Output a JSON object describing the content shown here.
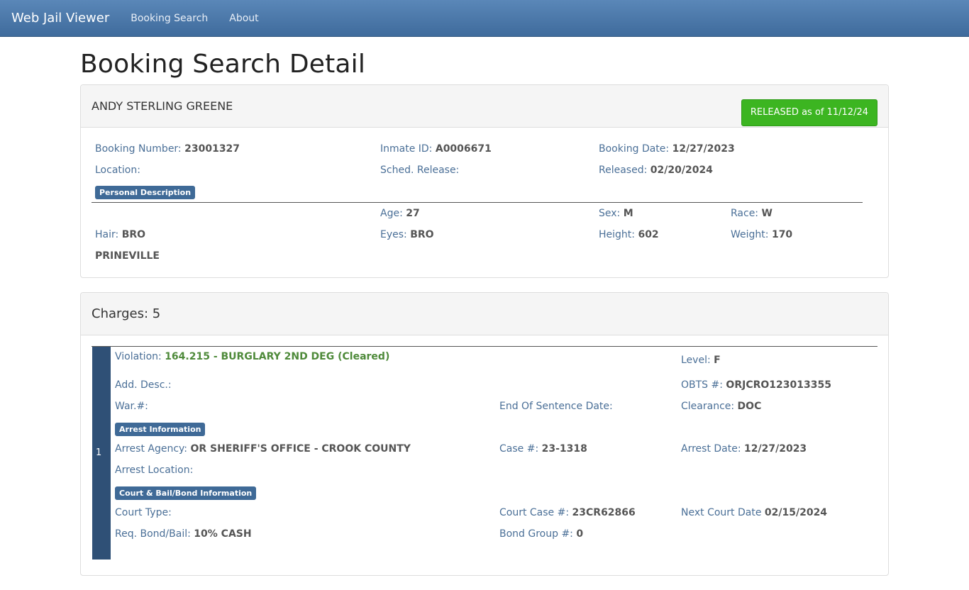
{
  "nav": {
    "brand": "Web Jail Viewer",
    "links": [
      "Booking Search",
      "About"
    ]
  },
  "page_title": "Booking Search Detail",
  "inmate": {
    "name": "ANDY STERLING GREENE",
    "status_button": "RELEASED as of 11/12/24",
    "booking_number_label": "Booking Number:",
    "booking_number": "23001327",
    "inmate_id_label": "Inmate ID:",
    "inmate_id": "A0006671",
    "booking_date_label": "Booking Date:",
    "booking_date": "12/27/2023",
    "location_label": "Location:",
    "sched_release_label": "Sched. Release:",
    "released_label": "Released:",
    "released": "02/20/2024",
    "personal_badge": "Personal Description",
    "age_label": "Age:",
    "age": "27",
    "sex_label": "Sex:",
    "sex": "M",
    "race_label": "Race:",
    "race": "W",
    "hair_label": "Hair:",
    "hair": "BRO",
    "eyes_label": "Eyes:",
    "eyes": "BRO",
    "height_label": "Height:",
    "height": "602",
    "weight_label": "Weight:",
    "weight": "170",
    "city": "PRINEVILLE"
  },
  "charges": {
    "heading": "Charges: 5",
    "items": [
      {
        "number": "1",
        "violation_label": "Violation:",
        "violation": "164.215 - BURGLARY 2ND DEG (Cleared)",
        "level_label": "Level:",
        "level": "F",
        "add_desc_label": "Add. Desc.:",
        "obts_label": "OBTS #:",
        "obts": "ORJCRO123013355",
        "war_label": "War.#:",
        "end_sentence_label": "End Of Sentence Date:",
        "clearance_label": "Clearance:",
        "clearance": "DOC",
        "arrest_badge": "Arrest Information",
        "arrest_agency_label": "Arrest Agency:",
        "arrest_agency": "OR SHERIFF'S OFFICE - CROOK COUNTY",
        "case_label": "Case #:",
        "case": "23-1318",
        "arrest_date_label": "Arrest Date:",
        "arrest_date": "12/27/2023",
        "arrest_location_label": "Arrest Location:",
        "court_badge": "Court & Bail/Bond Information",
        "court_type_label": "Court Type:",
        "court_case_label": "Court Case #:",
        "court_case": "23CR62866",
        "next_court_label": "Next Court Date",
        "next_court": "02/15/2024",
        "req_bond_label": "Req. Bond/Bail:",
        "req_bond": "10% CASH",
        "bond_group_label": "Bond Group #:",
        "bond_group": "0"
      }
    ]
  }
}
